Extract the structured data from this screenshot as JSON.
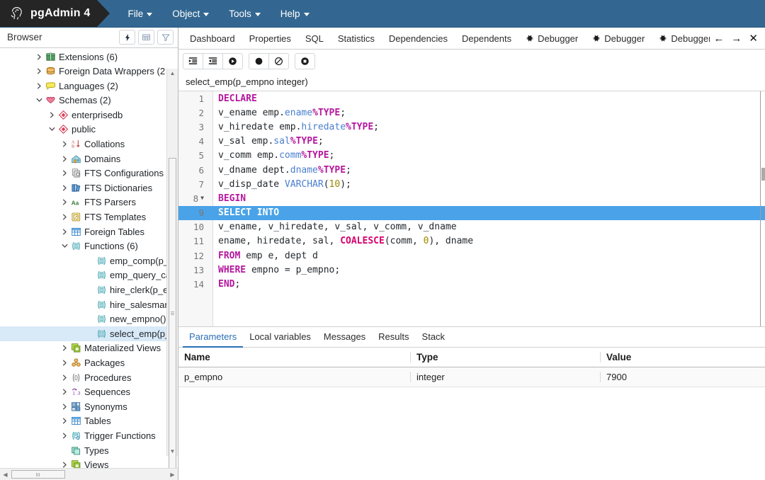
{
  "app": {
    "brand": "pgAdmin 4",
    "logo_icon": "elephant-logo",
    "menus": [
      {
        "label": "File",
        "icon": "chevron-down-icon"
      },
      {
        "label": "Object",
        "icon": "chevron-down-icon"
      },
      {
        "label": "Tools",
        "icon": "chevron-down-icon"
      },
      {
        "label": "Help",
        "icon": "chevron-down-icon"
      }
    ]
  },
  "colors": {
    "header_blue": "#336791",
    "brand_black": "#252525",
    "tab_active_blue": "#2a6fb5",
    "selection_blue": "#4aa3e8",
    "tree_selected": "#d8e9f7"
  },
  "sidebar": {
    "title": "Browser",
    "tools": [
      {
        "name": "quick-search-icon",
        "glyph": "bolt"
      },
      {
        "name": "grid-icon",
        "glyph": "grid"
      },
      {
        "name": "filter-icon",
        "glyph": "funnel"
      }
    ],
    "tree": [
      {
        "label": "Extensions (6)",
        "indent": 1,
        "twisty": "collapsed",
        "icon": "extensions-icon",
        "selected": false
      },
      {
        "label": "Foreign Data Wrappers (2",
        "indent": 1,
        "twisty": "collapsed",
        "icon": "foreign-data-wrapper-icon",
        "selected": false
      },
      {
        "label": "Languages (2)",
        "indent": 1,
        "twisty": "collapsed",
        "icon": "language-icon",
        "selected": false
      },
      {
        "label": "Schemas (2)",
        "indent": 1,
        "twisty": "expanded",
        "icon": "schemas-icon",
        "selected": false
      },
      {
        "label": "enterprisedb",
        "indent": 2,
        "twisty": "collapsed",
        "icon": "schema-icon",
        "selected": false
      },
      {
        "label": "public",
        "indent": 2,
        "twisty": "expanded",
        "icon": "schema-icon",
        "selected": false
      },
      {
        "label": "Collations",
        "indent": 3,
        "twisty": "collapsed",
        "icon": "collation-icon",
        "selected": false
      },
      {
        "label": "Domains",
        "indent": 3,
        "twisty": "collapsed",
        "icon": "domain-icon",
        "selected": false
      },
      {
        "label": "FTS Configurations",
        "indent": 3,
        "twisty": "collapsed",
        "icon": "fts-configuration-icon",
        "selected": false
      },
      {
        "label": "FTS Dictionaries",
        "indent": 3,
        "twisty": "collapsed",
        "icon": "fts-dictionary-icon",
        "selected": false
      },
      {
        "label": "FTS Parsers",
        "indent": 3,
        "twisty": "collapsed",
        "icon": "fts-parser-icon",
        "selected": false
      },
      {
        "label": "FTS Templates",
        "indent": 3,
        "twisty": "collapsed",
        "icon": "fts-template-icon",
        "selected": false
      },
      {
        "label": "Foreign Tables",
        "indent": 3,
        "twisty": "collapsed",
        "icon": "foreign-table-icon",
        "selected": false
      },
      {
        "label": "Functions (6)",
        "indent": 3,
        "twisty": "expanded",
        "icon": "functions-icon",
        "selected": false
      },
      {
        "label": "emp_comp(p_s",
        "indent": 5,
        "twisty": "none",
        "icon": "function-icon",
        "selected": false
      },
      {
        "label": "emp_query_cal",
        "indent": 5,
        "twisty": "none",
        "icon": "function-icon",
        "selected": false
      },
      {
        "label": "hire_clerk(p_en",
        "indent": 5,
        "twisty": "none",
        "icon": "function-icon",
        "selected": false
      },
      {
        "label": "hire_salesman(",
        "indent": 5,
        "twisty": "none",
        "icon": "function-icon",
        "selected": false
      },
      {
        "label": "new_empno()",
        "indent": 5,
        "twisty": "none",
        "icon": "function-icon",
        "selected": false
      },
      {
        "label": "select_emp(p_e",
        "indent": 5,
        "twisty": "none",
        "icon": "function-icon",
        "selected": true
      },
      {
        "label": "Materialized Views",
        "indent": 3,
        "twisty": "collapsed",
        "icon": "materialized-view-icon",
        "selected": false
      },
      {
        "label": "Packages",
        "indent": 3,
        "twisty": "collapsed",
        "icon": "package-icon",
        "selected": false
      },
      {
        "label": "Procedures",
        "indent": 3,
        "twisty": "collapsed",
        "icon": "procedure-icon",
        "selected": false
      },
      {
        "label": "Sequences",
        "indent": 3,
        "twisty": "collapsed",
        "icon": "sequence-icon",
        "selected": false
      },
      {
        "label": "Synonyms",
        "indent": 3,
        "twisty": "collapsed",
        "icon": "synonym-icon",
        "selected": false
      },
      {
        "label": "Tables",
        "indent": 3,
        "twisty": "collapsed",
        "icon": "table-icon",
        "selected": false
      },
      {
        "label": "Trigger Functions",
        "indent": 3,
        "twisty": "collapsed",
        "icon": "trigger-function-icon",
        "selected": false
      },
      {
        "label": "Types",
        "indent": 3,
        "twisty": "none",
        "icon": "type-icon",
        "selected": false
      },
      {
        "label": "Views",
        "indent": 3,
        "twisty": "collapsed",
        "icon": "view-icon",
        "selected": false
      }
    ]
  },
  "main": {
    "object_tabs": [
      {
        "label": "Dashboard",
        "icon": null,
        "active": false
      },
      {
        "label": "Properties",
        "icon": null,
        "active": false
      },
      {
        "label": "SQL",
        "icon": null,
        "active": false
      },
      {
        "label": "Statistics",
        "icon": null,
        "active": false
      },
      {
        "label": "Dependencies",
        "icon": null,
        "active": false
      },
      {
        "label": "Dependents",
        "icon": null,
        "active": false
      },
      {
        "label": "Debugger",
        "icon": "bug-icon",
        "active": false
      },
      {
        "label": "Debugger",
        "icon": "bug-icon",
        "active": false
      },
      {
        "label": "Debugger",
        "icon": "bug-icon",
        "active": false
      }
    ],
    "tab_nav": [
      {
        "name": "tabs-scroll-left-button",
        "glyph": "←"
      },
      {
        "name": "tabs-scroll-right-button",
        "glyph": "→"
      },
      {
        "name": "tabs-close-button",
        "glyph": "✕"
      }
    ],
    "debugger_toolbar": [
      {
        "name": "step-into-button",
        "icon": "step-into-icon"
      },
      {
        "name": "step-over-button",
        "icon": "step-over-icon"
      },
      {
        "name": "continue-button",
        "icon": "play-circle-icon"
      },
      {
        "name": "toggle-breakpoint-button",
        "icon": "breakpoint-dot-icon"
      },
      {
        "name": "clear-breakpoints-button",
        "icon": "no-entry-icon"
      },
      {
        "name": "stop-button",
        "icon": "stop-circle-icon"
      }
    ],
    "function_signature": "select_emp(p_empno integer)"
  },
  "editor": {
    "highlighted_line": 9,
    "lines": [
      {
        "no": "1",
        "fold": false,
        "tokens": [
          {
            "t": "DECLARE",
            "c": "kw"
          }
        ]
      },
      {
        "no": "2",
        "fold": false,
        "tokens": [
          {
            "t": "v_ename emp.",
            "c": "pl"
          },
          {
            "t": "ename",
            "c": "fld"
          },
          {
            "t": "%TYPE",
            "c": "typ"
          },
          {
            "t": ";",
            "c": "pl"
          }
        ]
      },
      {
        "no": "3",
        "fold": false,
        "tokens": [
          {
            "t": "v_hiredate emp.",
            "c": "pl"
          },
          {
            "t": "hiredate",
            "c": "fld"
          },
          {
            "t": "%TYPE",
            "c": "typ"
          },
          {
            "t": ";",
            "c": "pl"
          }
        ]
      },
      {
        "no": "4",
        "fold": false,
        "tokens": [
          {
            "t": "v_sal emp.",
            "c": "pl"
          },
          {
            "t": "sal",
            "c": "fld"
          },
          {
            "t": "%TYPE",
            "c": "typ"
          },
          {
            "t": ";",
            "c": "pl"
          }
        ]
      },
      {
        "no": "5",
        "fold": false,
        "tokens": [
          {
            "t": "v_comm emp.",
            "c": "pl"
          },
          {
            "t": "comm",
            "c": "fld"
          },
          {
            "t": "%TYPE",
            "c": "typ"
          },
          {
            "t": ";",
            "c": "pl"
          }
        ]
      },
      {
        "no": "6",
        "fold": false,
        "tokens": [
          {
            "t": "v_dname dept.",
            "c": "pl"
          },
          {
            "t": "dname",
            "c": "fld"
          },
          {
            "t": "%TYPE",
            "c": "typ"
          },
          {
            "t": ";",
            "c": "pl"
          }
        ]
      },
      {
        "no": "7",
        "fold": false,
        "tokens": [
          {
            "t": "v_disp_date ",
            "c": "pl"
          },
          {
            "t": "VARCHAR",
            "c": "fld"
          },
          {
            "t": "(",
            "c": "pl"
          },
          {
            "t": "10",
            "c": "num"
          },
          {
            "t": ");",
            "c": "pl"
          }
        ]
      },
      {
        "no": "8",
        "fold": true,
        "tokens": [
          {
            "t": "BEGIN",
            "c": "kw"
          }
        ]
      },
      {
        "no": "9",
        "fold": false,
        "tokens": [
          {
            "t": "SELECT INTO",
            "c": "kw"
          }
        ]
      },
      {
        "no": "10",
        "fold": false,
        "tokens": [
          {
            "t": "v_ename, v_hiredate, v_sal, v_comm, v_dname",
            "c": "pl"
          }
        ]
      },
      {
        "no": "11",
        "fold": false,
        "tokens": [
          {
            "t": "ename, hiredate, sal, ",
            "c": "pl"
          },
          {
            "t": "COALESCE",
            "c": "fn"
          },
          {
            "t": "(comm, ",
            "c": "pl"
          },
          {
            "t": "0",
            "c": "num"
          },
          {
            "t": "), dname",
            "c": "pl"
          }
        ]
      },
      {
        "no": "12",
        "fold": false,
        "tokens": [
          {
            "t": "FROM",
            "c": "kw"
          },
          {
            "t": " emp e, dept d",
            "c": "pl"
          }
        ]
      },
      {
        "no": "13",
        "fold": false,
        "tokens": [
          {
            "t": "WHERE",
            "c": "kw"
          },
          {
            "t": " empno = p_empno;",
            "c": "pl"
          }
        ]
      },
      {
        "no": "14",
        "fold": false,
        "tokens": [
          {
            "t": "END",
            "c": "kw"
          },
          {
            "t": ";",
            "c": "pl"
          }
        ]
      }
    ]
  },
  "bottom": {
    "tabs": [
      {
        "label": "Parameters",
        "active": true
      },
      {
        "label": "Local variables",
        "active": false
      },
      {
        "label": "Messages",
        "active": false
      },
      {
        "label": "Results",
        "active": false
      },
      {
        "label": "Stack",
        "active": false
      }
    ],
    "columns": [
      "Name",
      "Type",
      "Value"
    ],
    "rows": [
      {
        "name": "p_empno",
        "type": "integer",
        "value": "7900"
      }
    ]
  }
}
